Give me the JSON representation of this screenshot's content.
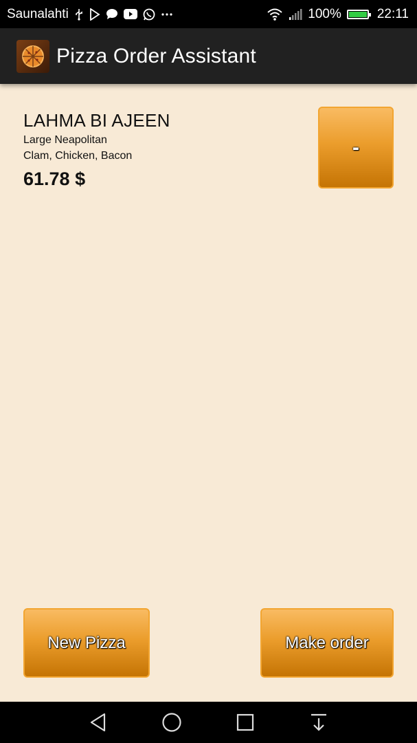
{
  "status_bar": {
    "carrier": "Saunalahti",
    "battery": "100%",
    "time": "22:11",
    "icons_left": [
      "usb-icon",
      "play-store-icon",
      "message-icon",
      "youtube-icon",
      "whatsapp-icon",
      "more-notifications-icon"
    ],
    "icons_right": [
      "wifi-icon",
      "signal-icon",
      "battery-icon"
    ]
  },
  "action_bar": {
    "title": "Pizza Order Assistant",
    "icon": "pizza-icon"
  },
  "order": {
    "items": [
      {
        "name": "LAHMA BI AJEEN",
        "size": "Large Neapolitan",
        "toppings": "Clam, Chicken, Bacon",
        "price": "61.78 $",
        "remove_label": "-"
      }
    ]
  },
  "buttons": {
    "new_pizza": "New Pizza",
    "make_order": "Make order"
  },
  "nav_bar": {
    "icons": [
      "back-icon",
      "home-icon",
      "recents-icon",
      "notification-pulldown-icon"
    ]
  },
  "colors": {
    "background": "#f8ead6",
    "action_bar": "#212121",
    "button_top": "#f9bb62",
    "button_bottom": "#c57404",
    "button_border": "#f2a531"
  }
}
